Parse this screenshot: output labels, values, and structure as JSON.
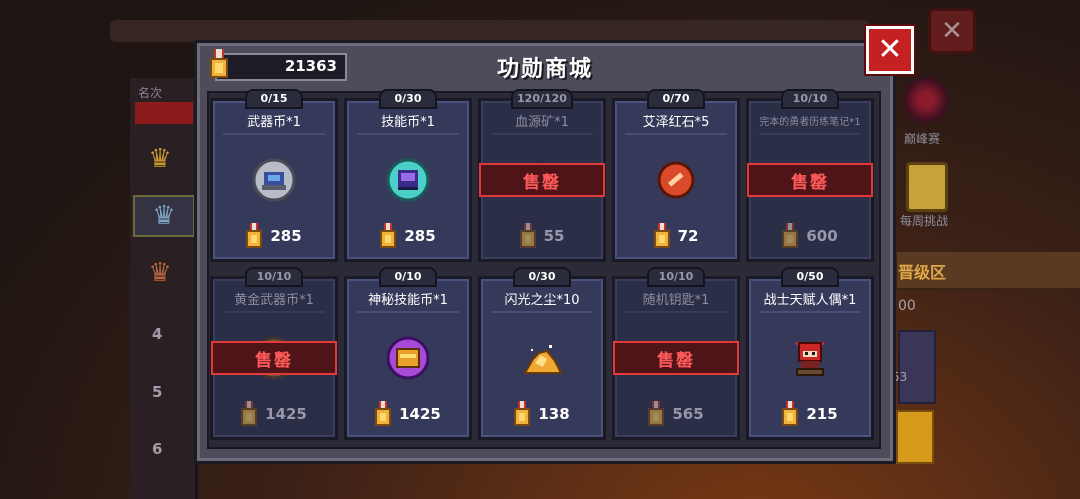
{
  "dialog": {
    "title": "功勋商城",
    "currency_value": "21363",
    "close_label": "✕"
  },
  "background": {
    "rank_header": "名次",
    "rank_numbers": [
      "4",
      "5",
      "6"
    ],
    "peak_label": "巅峰赛",
    "weekly_label": "每周挑战",
    "promo_label": "晋级区",
    "side_text1": "00",
    "side_text2": "53",
    "close_label": "✕"
  },
  "sold_out_label": "售罄",
  "items": [
    {
      "name": "武器币*1",
      "limit": "0/15",
      "price": "285",
      "sold_out": false,
      "icon": "weapon-coin-icon"
    },
    {
      "name": "技能币*1",
      "limit": "0/30",
      "price": "285",
      "sold_out": false,
      "icon": "skill-coin-icon"
    },
    {
      "name": "血源矿*1",
      "limit": "120/120",
      "price": "55",
      "sold_out": true,
      "icon": "blood-ore-icon"
    },
    {
      "name": "艾泽红石*5",
      "limit": "0/70",
      "price": "72",
      "sold_out": false,
      "icon": "red-stone-icon"
    },
    {
      "name": "完本的勇者历练笔记*1",
      "limit": "10/10",
      "price": "600",
      "sold_out": true,
      "icon": "notebook-icon"
    },
    {
      "name": "黄金武器币*1",
      "limit": "10/10",
      "price": "1425",
      "sold_out": true,
      "icon": "gold-weapon-coin-icon"
    },
    {
      "name": "神秘技能币*1",
      "limit": "0/10",
      "price": "1425",
      "sold_out": false,
      "icon": "mystic-skill-coin-icon"
    },
    {
      "name": "闪光之尘*10",
      "limit": "0/30",
      "price": "138",
      "sold_out": false,
      "icon": "glitter-dust-icon"
    },
    {
      "name": "随机钥匙*1",
      "limit": "10/10",
      "price": "565",
      "sold_out": true,
      "icon": "random-key-icon"
    },
    {
      "name": "战士天赋人偶*1",
      "limit": "0/50",
      "price": "215",
      "sold_out": false,
      "icon": "warrior-doll-icon"
    }
  ],
  "colors": {
    "accent_red": "#c42222",
    "medal_gold": "#e8a82a",
    "card_bg": "#363a5a"
  }
}
